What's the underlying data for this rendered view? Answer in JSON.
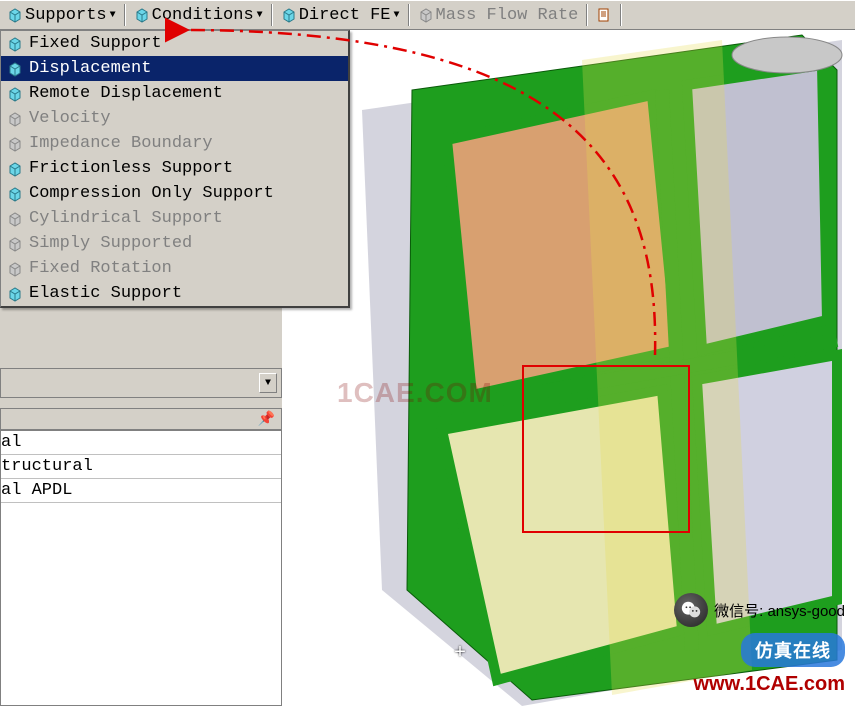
{
  "toolbar": {
    "supports": "Supports",
    "conditions": "Conditions",
    "direct_fe": "Direct FE",
    "mass_flow": "Mass Flow Rate"
  },
  "supports_menu": [
    {
      "label": "Fixed Support",
      "enabled": true
    },
    {
      "label": "Displacement",
      "enabled": true,
      "selected": true
    },
    {
      "label": "Remote Displacement",
      "enabled": true
    },
    {
      "label": "Velocity",
      "enabled": false
    },
    {
      "label": "Impedance Boundary",
      "enabled": false
    },
    {
      "label": "Frictionless Support",
      "enabled": true
    },
    {
      "label": "Compression Only Support",
      "enabled": true
    },
    {
      "label": "Cylindrical Support",
      "enabled": false
    },
    {
      "label": "Simply Supported",
      "enabled": false
    },
    {
      "label": "Fixed Rotation",
      "enabled": false
    },
    {
      "label": "Elastic Support",
      "enabled": true
    }
  ],
  "panel_rows": [
    "al",
    "tructural",
    "al APDL"
  ],
  "watermark": "1CAE.COM",
  "wechat_label": "微信号: ansys-good",
  "sim_label": "仿真在线",
  "site_url": "www.1CAE.com"
}
